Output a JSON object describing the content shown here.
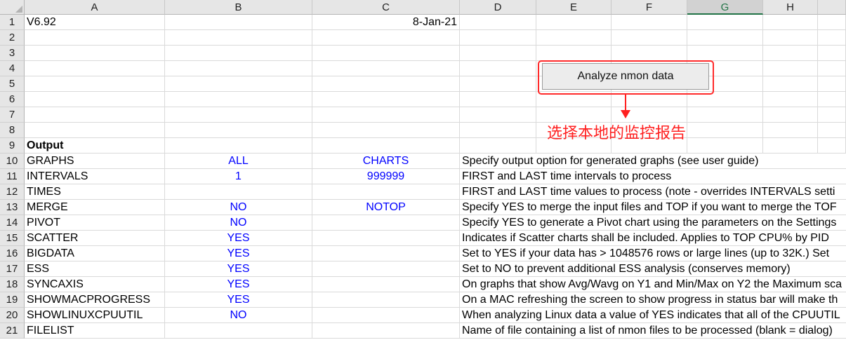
{
  "columns": [
    "A",
    "B",
    "C",
    "D",
    "E",
    "F",
    "G",
    "H"
  ],
  "selected_column": "G",
  "rows": [
    {
      "num": "1",
      "a": "V6.92",
      "b": "",
      "c": "8-Jan-21",
      "d": "",
      "a_bold": false
    },
    {
      "num": "2",
      "a": "",
      "b": "",
      "c": "",
      "d": ""
    },
    {
      "num": "3",
      "a": "",
      "b": "",
      "c": "",
      "d": ""
    },
    {
      "num": "4",
      "a": "",
      "b": "",
      "c": "",
      "d": ""
    },
    {
      "num": "5",
      "a": "",
      "b": "",
      "c": "",
      "d": ""
    },
    {
      "num": "6",
      "a": "",
      "b": "",
      "c": "",
      "d": ""
    },
    {
      "num": "7",
      "a": "",
      "b": "",
      "c": "",
      "d": ""
    },
    {
      "num": "8",
      "a": "",
      "b": "",
      "c": "",
      "d": ""
    },
    {
      "num": "9",
      "a": "Output",
      "b": "",
      "c": "",
      "d": "",
      "a_bold": true
    },
    {
      "num": "10",
      "a": "GRAPHS",
      "b": "ALL",
      "c": "CHARTS",
      "d": "Specify output option for generated graphs (see user guide)"
    },
    {
      "num": "11",
      "a": "INTERVALS",
      "b": "1",
      "c": "999999",
      "d": "FIRST and LAST time intervals to process"
    },
    {
      "num": "12",
      "a": "TIMES",
      "b": "",
      "c": "",
      "d": "FIRST and LAST time values to process (note - overrides INTERVALS setti"
    },
    {
      "num": "13",
      "a": "MERGE",
      "b": "NO",
      "c": "NOTOP",
      "d": "Specify YES to merge the input files and TOP if you want to merge the TOF"
    },
    {
      "num": "14",
      "a": "PIVOT",
      "b": "NO",
      "c": "",
      "d": "Specify YES to generate a Pivot chart using the parameters on the Settings"
    },
    {
      "num": "15",
      "a": "SCATTER",
      "b": "YES",
      "c": "",
      "d": "Indicates if Scatter charts shall be included.  Applies to TOP CPU% by PID"
    },
    {
      "num": "16",
      "a": "BIGDATA",
      "b": "YES",
      "c": "",
      "d": "Set to YES if your data has > 1048576 rows or large lines (up to 32K.)  Set"
    },
    {
      "num": "17",
      "a": "ESS",
      "b": "YES",
      "c": "",
      "d": "Set to NO to prevent additional ESS analysis (conserves memory)"
    },
    {
      "num": "18",
      "a": "SYNCAXIS",
      "b": "YES",
      "c": "",
      "d": "On graphs that show Avg/Wavg on Y1 and Min/Max on Y2 the Maximum sca"
    },
    {
      "num": "19",
      "a": "SHOWMACPROGRESS",
      "b": "YES",
      "c": "",
      "d": "On a MAC refreshing the screen to show progress in status bar will make th"
    },
    {
      "num": "20",
      "a": "SHOWLINUXCPUUTIL",
      "b": "NO",
      "c": "",
      "d": "When analyzing Linux data a value of YES indicates that all of the CPUUTIL"
    },
    {
      "num": "21",
      "a": "FILELIST",
      "b": "",
      "c": "",
      "d": "Name of file containing a list of nmon files to be processed (blank = dialog)"
    }
  ],
  "button": {
    "label": "Analyze nmon data"
  },
  "annotation": {
    "text": "选择本地的监控报告",
    "color": "#ff2020"
  },
  "colors": {
    "value_blue": "#0000ff",
    "highlight_red": "#ff2a2a",
    "selected_header": "#217346"
  }
}
